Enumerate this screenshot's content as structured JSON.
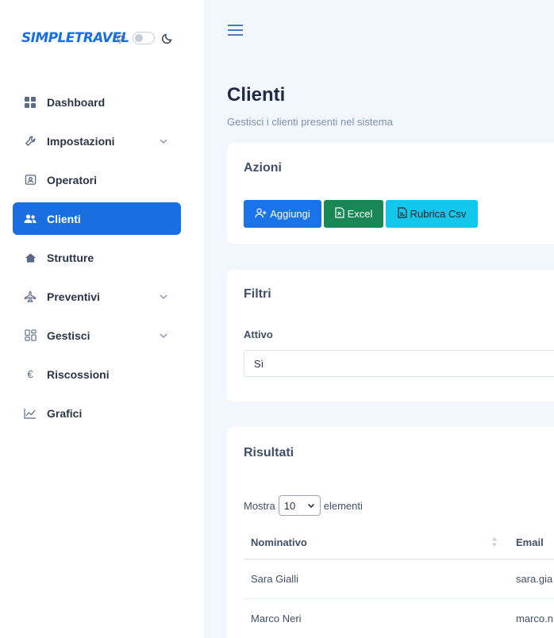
{
  "brand": {
    "logo_text": "SIMPLETRAVEL"
  },
  "theme_toggle": {
    "light_icon": "sun-icon",
    "dark_icon": "moon-icon"
  },
  "sidebar": {
    "items": [
      {
        "label": "Dashboard",
        "icon": "dashboard-icon",
        "active": false,
        "expandable": false
      },
      {
        "label": "Impostazioni",
        "icon": "wrench-icon",
        "active": false,
        "expandable": true
      },
      {
        "label": "Operatori",
        "icon": "id-badge-icon",
        "active": false,
        "expandable": false
      },
      {
        "label": "Clienti",
        "icon": "users-icon",
        "active": true,
        "expandable": false
      },
      {
        "label": "Strutture",
        "icon": "home-icon",
        "active": false,
        "expandable": false
      },
      {
        "label": "Preventivi",
        "icon": "plane-icon",
        "active": false,
        "expandable": true
      },
      {
        "label": "Gestisci",
        "icon": "grid-icon",
        "active": false,
        "expandable": true
      },
      {
        "label": "Riscossioni",
        "icon": "euro-icon",
        "active": false,
        "expandable": false
      },
      {
        "label": "Grafici",
        "icon": "chart-line-icon",
        "active": false,
        "expandable": false
      }
    ]
  },
  "header": {
    "menu_icon": "hamburger-icon"
  },
  "page": {
    "title": "Clienti",
    "subtitle": "Gestisci i clienti presenti nel sistema"
  },
  "actions": {
    "title": "Azioni",
    "add_label": "Aggiungi",
    "excel_label": "Excel",
    "csv_label": "Rubrica Csv"
  },
  "filters": {
    "title": "Filtri",
    "attivo_label": "Attivo",
    "attivo_value": "Sì"
  },
  "results": {
    "title": "Risultati",
    "show_label": "Mostra",
    "page_length": "10",
    "elements_label": "elementi",
    "columns": [
      "Nominativo",
      "Email"
    ],
    "rows": [
      {
        "nominativo": "Sara Gialli",
        "email": "sara.gia"
      },
      {
        "nominativo": "Marco Neri",
        "email": "marco.n"
      }
    ]
  },
  "colors": {
    "primary": "#1a6fe0",
    "success": "#198754",
    "info": "#13c6ec",
    "background": "#f2f6fd"
  }
}
